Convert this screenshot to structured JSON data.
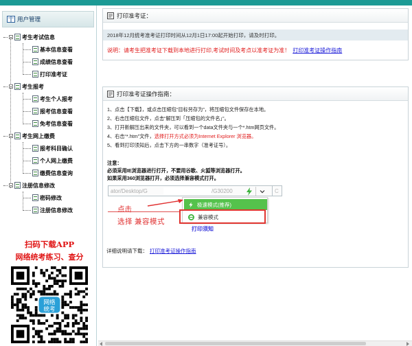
{
  "sidebar": {
    "header": "用户管理",
    "groups": [
      {
        "label": "考生考试信息",
        "items": [
          "基本信息查看",
          "成绩信息查看",
          "打印准考证"
        ]
      },
      {
        "label": "考生报考",
        "items": [
          "考生个人报考",
          "报考信息查看",
          "免考信息查看"
        ]
      },
      {
        "label": "考生网上缴费",
        "items": [
          "报考科目确认",
          "个人网上缴费",
          "缴费信息查询"
        ]
      },
      {
        "label": "注册信息修改",
        "items": [
          "密码修改",
          "注册信息修改"
        ]
      }
    ],
    "promo": {
      "line1": "扫码下载APP",
      "line2": "网络统考练习、查分",
      "qr_badge": "网络统考"
    }
  },
  "print_panel": {
    "title": "打印准考证：",
    "notice": "2018年12月统考准考证打印时间从12月1日17:00起开始打印，请及时打印。",
    "warning": "说明：请考生把准考证下载到本地进行打印,考试时间及考点以准考证为准！",
    "guide_link": "打印准考证操作指南"
  },
  "guide_panel": {
    "title": "打印准考证操作指南：",
    "steps": [
      {
        "text": "1、点击【下载】，或点击压缩包“目标另存为”，将压缩包文件保存在本地。"
      },
      {
        "text": "2、右击压缩包文件，点击“解压到「压缩包的文件名」”。"
      },
      {
        "text": "3、打开新解压出来的文件夹，可以看到一个data文件夹与一个*.htm网页文件。"
      },
      {
        "text": "4、右击“*.htm”文件，",
        "red": "选择打开方式必须为Internet Explorer 浏览器。"
      },
      {
        "text": "5、看到打印须知后，点击下方的一串数字（准考证号）。"
      }
    ],
    "notes": [
      "注意：",
      "必须采用IE浏览器进行打开，不要用谷歌、火狐等浏览器打开。",
      "如果采用360浏览器打开，必须选择兼容模式打开。"
    ],
    "address_left": "ator/Desktop/G",
    "address_right": "/G30200",
    "dropdown": {
      "fast_mode": "极速模式(推荐)",
      "compat_mode": "兼容模式"
    },
    "annotation_click": "点击",
    "annotation_select": "选择",
    "annotation_compat": "兼容模式",
    "overlay_fragment": "打印须知",
    "detail_prefix": "详细说明请下载：",
    "detail_link": "打印准考证操作指南"
  },
  "colors": {
    "teal": "#1c9a95",
    "red": "#e01a1a",
    "link": "#1a1ad8",
    "green": "#55c24c"
  }
}
